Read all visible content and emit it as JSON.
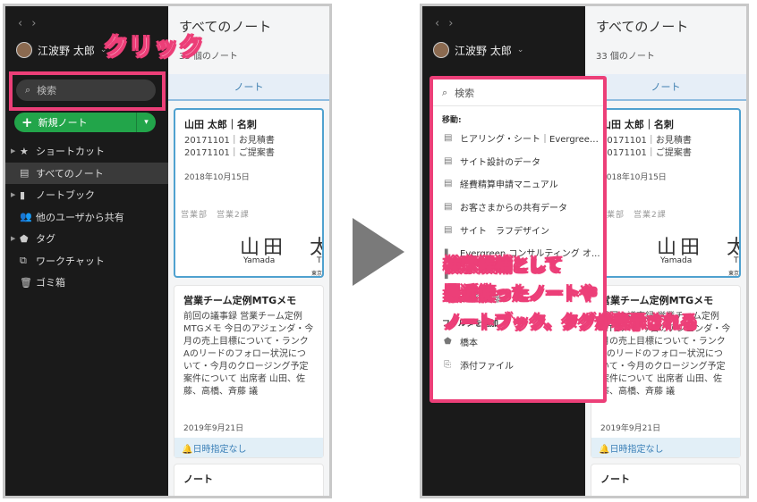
{
  "sidebar": {
    "nav_back": "‹",
    "nav_forward": "›",
    "user_name": "江波野 太郎",
    "search_placeholder": "検索",
    "new_note_label": "新規ノート",
    "items": [
      {
        "label": "ショートカット",
        "icon": "star-icon",
        "glyph": "★",
        "expandable": true
      },
      {
        "label": "すべてのノート",
        "icon": "note-icon",
        "glyph": "▤",
        "expandable": false,
        "active": true
      },
      {
        "label": "ノートブック",
        "icon": "notebook-icon",
        "glyph": "▮",
        "expandable": true
      },
      {
        "label": "他のユーザから共有",
        "icon": "people-icon",
        "glyph": "👥",
        "expandable": false
      },
      {
        "label": "タグ",
        "icon": "tag-icon",
        "glyph": "⬟",
        "expandable": true
      },
      {
        "label": "ワークチャット",
        "icon": "chat-icon",
        "glyph": "⧉",
        "expandable": false
      },
      {
        "label": "ゴミ箱",
        "icon": "trash-icon",
        "glyph": "🗑",
        "expandable": false
      }
    ]
  },
  "notes_list": {
    "title": "すべてのノート",
    "count": "33 個のノート",
    "tab": "ノート",
    "cards": [
      {
        "title": "山田 太郎｜名刺",
        "body": "20171101｜お見積書 20171101｜ご提案書",
        "date": "2018年10月15日",
        "thumb_small": "営業部　営業2課",
        "thumb_big": "山田　太",
        "thumb_roman": "Yamada",
        "thumb_t": "T",
        "thumb_t3": "東京"
      },
      {
        "title": "営業チーム定例MTGメモ",
        "body": "前回の議事録 営業チーム定例MTGメモ 今日のアジェンダ・今月の売上目標について・ランクAのリードのフォロー状況について・今月のクロージング予定案件について 出席者 山田、佐藤、高橋、斉藤 議",
        "date": "2019年9月21日",
        "reminder": "🔔日時指定なし"
      },
      {
        "title": "ノート"
      }
    ]
  },
  "dropdown": {
    "search_value": "検索",
    "section_move": "移動:",
    "items": [
      {
        "label": "ヒアリング・シート｜Evergreen ...",
        "icon": "note-icon",
        "glyph": "▤"
      },
      {
        "label": "サイト設計のデータ",
        "icon": "note-icon",
        "glyph": "▤"
      },
      {
        "label": "経費精算申請マニュアル",
        "icon": "note-icon",
        "glyph": "▤"
      },
      {
        "label": "お客さまからの共有データ",
        "icon": "note-icon",
        "glyph": "▤"
      },
      {
        "label": "サイト　ラフデザイン",
        "icon": "note-icon",
        "glyph": "▤"
      },
      {
        "label": "Evergreen コンサルティング オ...",
        "icon": "notebook-icon",
        "glyph": "▮"
      },
      {
        "label": "",
        "icon": "notebook-icon",
        "glyph": "▮"
      },
      {
        "label": "02.経理部",
        "icon": "notebook-icon",
        "glyph": "▮"
      },
      {
        "label": "フィルタを追加",
        "icon": "",
        "glyph": "",
        "section": true
      },
      {
        "label": "橋本",
        "icon": "tag-icon",
        "glyph": "⬟"
      },
      {
        "label": "添付ファイル",
        "icon": "attachment-icon",
        "glyph": "⎘"
      }
    ]
  },
  "annotations": {
    "click": "クリック",
    "line1": "検索候補として",
    "line2": "最近使ったノートや",
    "line3": "ノートブック、タグが表示される"
  },
  "colors": {
    "highlight": "#ec3f78",
    "sidebar_bg": "#1a1a1a",
    "new_note_green": "#22a54a",
    "arrow_gray": "#7a7a7a"
  }
}
